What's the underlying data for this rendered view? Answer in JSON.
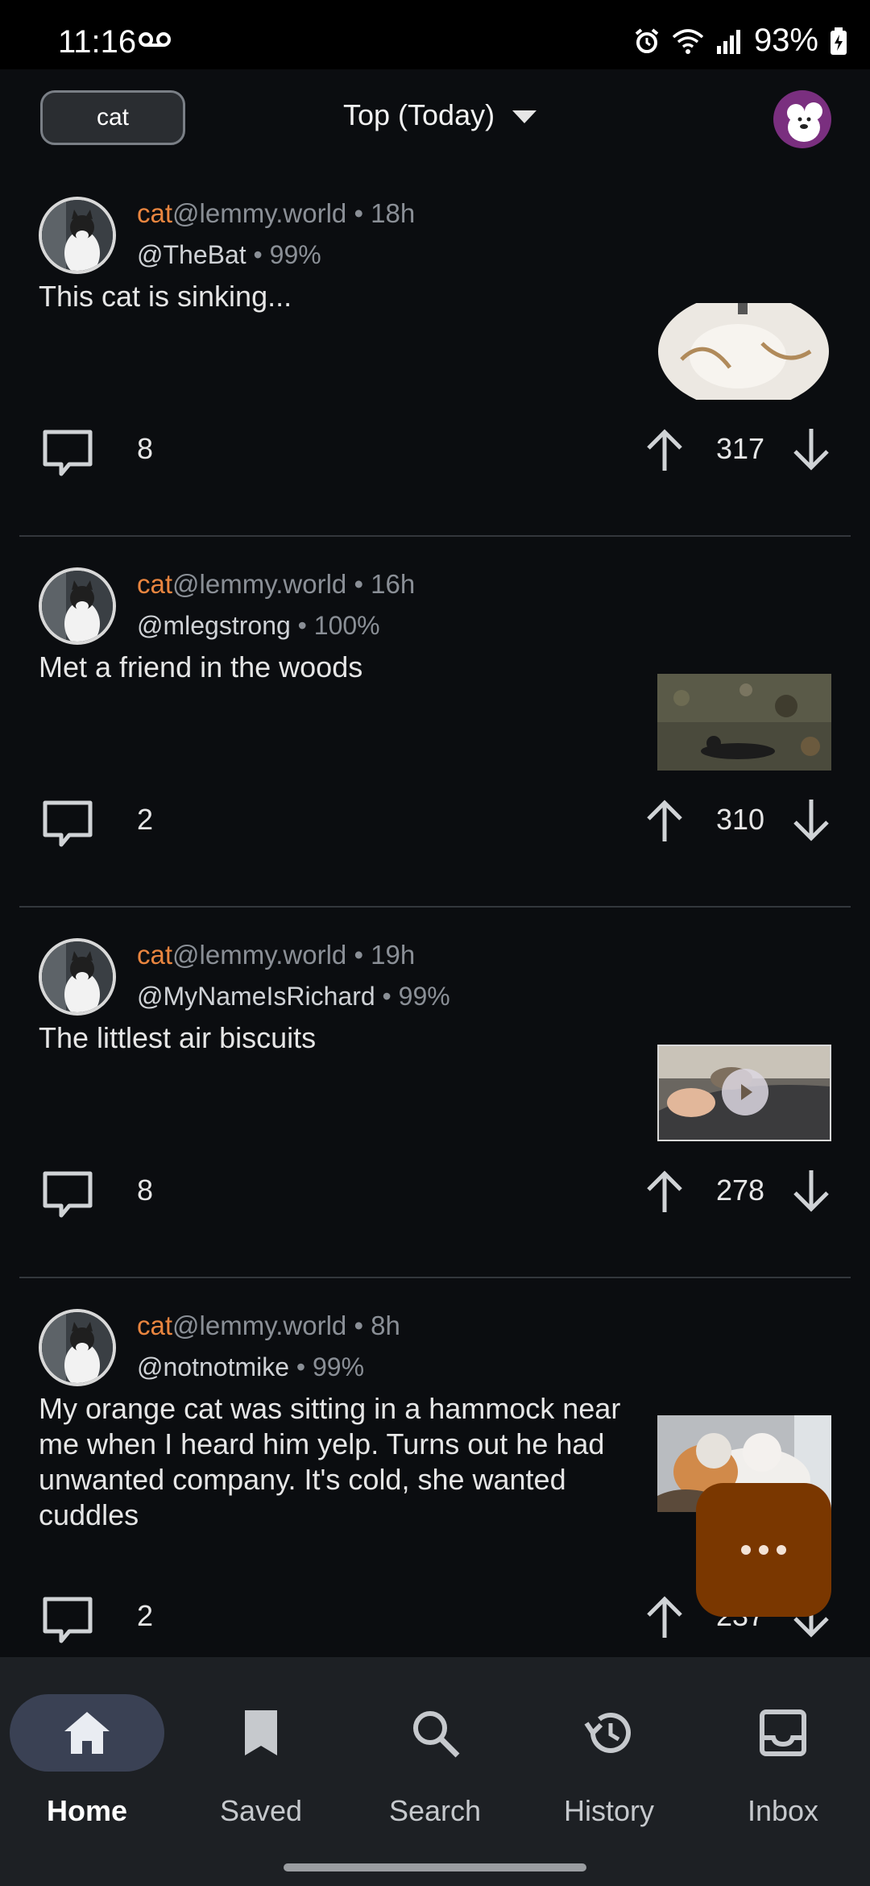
{
  "status_bar": {
    "time": "11:16",
    "battery": "93%"
  },
  "top_bar": {
    "community": "cat",
    "sort": "Top (Today)"
  },
  "posts": [
    {
      "community": "cat",
      "instance": "@lemmy.world",
      "age": "18h",
      "user": "@TheBat",
      "upvote_pct": "99%",
      "title": "This cat is sinking...",
      "comments": "8",
      "score": "317"
    },
    {
      "community": "cat",
      "instance": "@lemmy.world",
      "age": "16h",
      "user": "@mlegstrong",
      "upvote_pct": "100%",
      "title": "Met a friend in the woods",
      "comments": "2",
      "score": "310"
    },
    {
      "community": "cat",
      "instance": "@lemmy.world",
      "age": "19h",
      "user": "@MyNameIsRichard",
      "upvote_pct": "99%",
      "title": "The littlest air biscuits",
      "comments": "8",
      "score": "278"
    },
    {
      "community": "cat",
      "instance": "@lemmy.world",
      "age": "8h",
      "user": "@notnotmike",
      "upvote_pct": "99%",
      "title": "My orange cat was sitting in a hammock near me when I heard him yelp. Turns out he had unwanted company. It's cold, she wanted cuddles",
      "comments": "2",
      "score": "237"
    }
  ],
  "bottom_nav": {
    "items": [
      {
        "label": "Home",
        "icon": "home-icon",
        "active": true
      },
      {
        "label": "Saved",
        "icon": "bookmark-icon",
        "active": false
      },
      {
        "label": "Search",
        "icon": "search-icon",
        "active": false
      },
      {
        "label": "History",
        "icon": "history-icon",
        "active": false
      },
      {
        "label": "Inbox",
        "icon": "inbox-icon",
        "active": false
      }
    ]
  },
  "colors": {
    "background": "#0b0d10",
    "community_accent": "#e9853f",
    "fab": "#7a3700",
    "nav_active_pill": "#3a4154"
  }
}
